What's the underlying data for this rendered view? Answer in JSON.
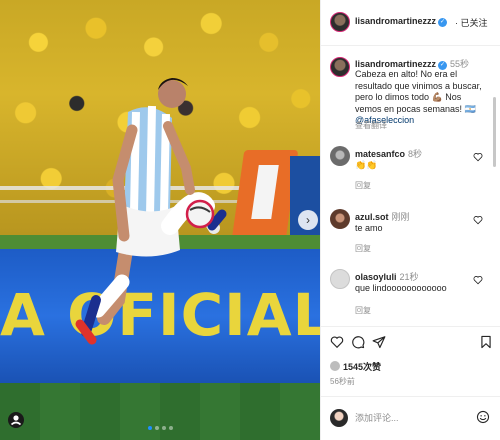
{
  "media": {
    "billboard_text": "A OFICIAL",
    "carousel_total": 4,
    "carousel_active": 1
  },
  "header": {
    "username": "lisandromartinezzz",
    "follow_state": "已关注"
  },
  "caption": {
    "username": "lisandromartinezzz",
    "time": "55秒",
    "text_before_mention": "Cabeza en alto! No era el resultado que vinimos a buscar, pero lo dimos todo 💪🏽 Nos vemos en pocas semanas! 🇦🇷 ",
    "mention": "@afaseleccion",
    "see_translation": "查看翻译"
  },
  "comments": [
    {
      "username": "matesanfco",
      "time": "8秒",
      "text": "👏👏",
      "reply": "回复"
    },
    {
      "username": "azul.sot",
      "time": "刚刚",
      "text": "te amo",
      "reply": "回复"
    },
    {
      "username": "olasoyluli",
      "time": "21秒",
      "text": "que lindoooooooooooo",
      "reply": "回复"
    }
  ],
  "stats": {
    "likes": "1545次赞",
    "posted": "56秒前"
  },
  "compose": {
    "placeholder": "添加评论..."
  },
  "icons": {
    "like": "heart-icon",
    "comment": "comment-icon",
    "share": "send-icon",
    "save": "bookmark-icon",
    "verified": "verified-badge-icon",
    "emoji": "emoji-icon",
    "next": "chevron-right-icon"
  },
  "colors": {
    "verified_blue": "#3897f0",
    "billboard_blue": "#1d5cc6",
    "billboard_yellow": "#e9d53c",
    "mention": "#00376b",
    "muted": "#8e8e8e"
  }
}
